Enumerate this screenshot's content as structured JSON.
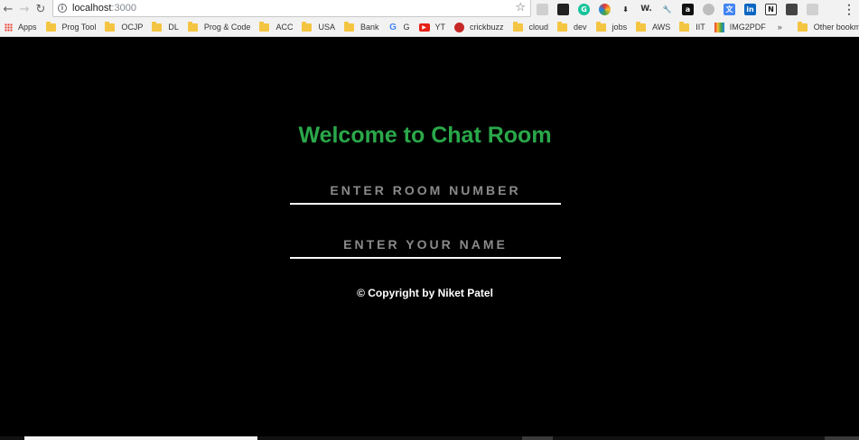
{
  "browser": {
    "url_host": "localhost",
    "url_port": ":3000",
    "bookmarks": [
      {
        "label": "Apps",
        "icon": "apps-grid-icon"
      },
      {
        "label": "Prog Tool",
        "icon": "folder-icon"
      },
      {
        "label": "OCJP",
        "icon": "folder-icon"
      },
      {
        "label": "DL",
        "icon": "folder-icon"
      },
      {
        "label": "Prog & Code",
        "icon": "folder-icon"
      },
      {
        "label": "ACC",
        "icon": "folder-icon"
      },
      {
        "label": "USA",
        "icon": "folder-icon"
      },
      {
        "label": "Bank",
        "icon": "folder-icon"
      },
      {
        "label": "G",
        "icon": "google-icon"
      },
      {
        "label": "YT",
        "icon": "youtube-icon"
      },
      {
        "label": "crickbuzz",
        "icon": "cricbuzz-icon"
      },
      {
        "label": "cloud",
        "icon": "folder-icon"
      },
      {
        "label": "dev",
        "icon": "folder-icon"
      },
      {
        "label": "jobs",
        "icon": "folder-icon"
      },
      {
        "label": "AWS",
        "icon": "folder-icon"
      },
      {
        "label": "IIT",
        "icon": "folder-icon"
      },
      {
        "label": "IMG2PDF",
        "icon": "img2pdf-icon"
      }
    ],
    "more_bookmarks": "»",
    "other_bookmarks": "Other bookmarks",
    "menu_icon": "⋮"
  },
  "page": {
    "title": "Welcome to Chat Room",
    "room_placeholder": "ENTER ROOM NUMBER",
    "name_placeholder": "ENTER YOUR NAME",
    "copyright": "© Copyright by Niket Patel"
  },
  "colors": {
    "background": "#000000",
    "title_green": "#2aa84a",
    "input_underline": "#ffffff",
    "placeholder": "#8a8a8a"
  }
}
